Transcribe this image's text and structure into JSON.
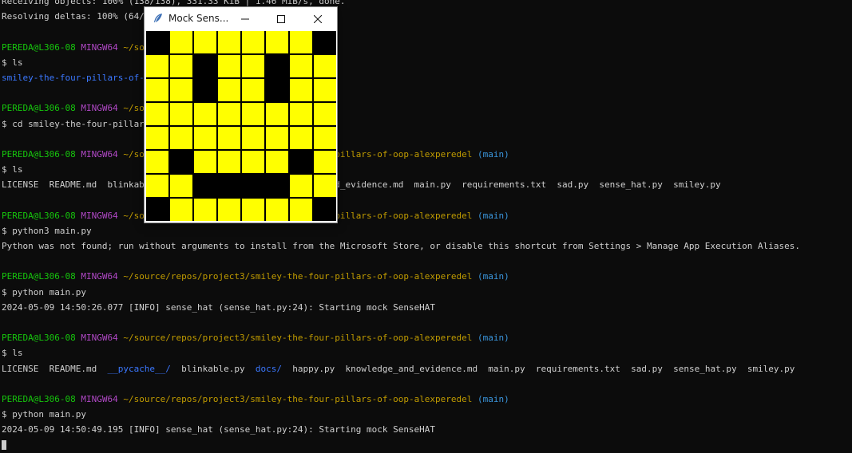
{
  "terminal": {
    "lines": [
      [
        {
          "t": "Receiving objects: 100% (138/138), 331.33 KiB | 1.46 MiB/s, done.",
          "c": "text"
        }
      ],
      [
        {
          "t": "Resolving deltas: 100% (64/64), done.",
          "c": "text"
        }
      ],
      [],
      [
        {
          "t": "PEREDA@L306-08",
          "c": "green"
        },
        {
          "t": " ",
          "c": "text"
        },
        {
          "t": "MINGW64",
          "c": "magenta"
        },
        {
          "t": " ~/source/repos/project3",
          "c": "yellow"
        }
      ],
      [
        {
          "t": "$ ls",
          "c": "text"
        }
      ],
      [
        {
          "t": "smiley-the-four-pillars-of-oop-alexperedel/",
          "c": "blue"
        }
      ],
      [],
      [
        {
          "t": "PEREDA@L306-08",
          "c": "green"
        },
        {
          "t": " ",
          "c": "text"
        },
        {
          "t": "MINGW64",
          "c": "magenta"
        },
        {
          "t": " ~/source/repos/project3",
          "c": "yellow"
        }
      ],
      [
        {
          "t": "$ cd smiley-the-four-pillars-of-oop-alexperedel/",
          "c": "text"
        }
      ],
      [],
      [
        {
          "t": "PEREDA@L306-08",
          "c": "green"
        },
        {
          "t": " ",
          "c": "text"
        },
        {
          "t": "MINGW64",
          "c": "magenta"
        },
        {
          "t": " ~/source/repos/project3/smiley-the-four-pillars-of-oop-alexperedel",
          "c": "yellow"
        },
        {
          "t": " (main)",
          "c": "cyan"
        }
      ],
      [
        {
          "t": "$ ls",
          "c": "text"
        }
      ],
      [
        {
          "t": "LICENSE  README.md  blinkable.py  docs/  happy.py  knowledge_and_evidence.md  main.py  requirements.txt  sad.py  sense_hat.py  smiley.py",
          "c": "text"
        }
      ],
      [],
      [
        {
          "t": "PEREDA@L306-08",
          "c": "green"
        },
        {
          "t": " ",
          "c": "text"
        },
        {
          "t": "MINGW64",
          "c": "magenta"
        },
        {
          "t": " ~/source/repos/project3/smiley-the-four-pillars-of-oop-alexperedel",
          "c": "yellow"
        },
        {
          "t": " (main)",
          "c": "cyan"
        }
      ],
      [
        {
          "t": "$ python3 main.py",
          "c": "text"
        }
      ],
      [
        {
          "t": "Python was not found; run without arguments to install from the Microsoft Store, or disable this shortcut from Settings > Manage App Execution Aliases.",
          "c": "text"
        }
      ],
      [],
      [
        {
          "t": "PEREDA@L306-08",
          "c": "green"
        },
        {
          "t": " ",
          "c": "text"
        },
        {
          "t": "MINGW64",
          "c": "magenta"
        },
        {
          "t": " ~/source/repos/project3/smiley-the-four-pillars-of-oop-alexperedel",
          "c": "yellow"
        },
        {
          "t": " (main)",
          "c": "cyan"
        }
      ],
      [
        {
          "t": "$ python main.py",
          "c": "text"
        }
      ],
      [
        {
          "t": "2024-05-09 14:50:26.077 [INFO] sense_hat (sense_hat.py:24): Starting mock SenseHAT",
          "c": "text"
        }
      ],
      [],
      [
        {
          "t": "PEREDA@L306-08",
          "c": "green"
        },
        {
          "t": " ",
          "c": "text"
        },
        {
          "t": "MINGW64",
          "c": "magenta"
        },
        {
          "t": " ~/source/repos/project3/smiley-the-four-pillars-of-oop-alexperedel",
          "c": "yellow"
        },
        {
          "t": " (main)",
          "c": "cyan"
        }
      ],
      [
        {
          "t": "$ ls",
          "c": "text"
        }
      ],
      [
        {
          "t": "LICENSE  README.md  ",
          "c": "text"
        },
        {
          "t": "__pycache__/",
          "c": "blue"
        },
        {
          "t": "  blinkable.py  ",
          "c": "text"
        },
        {
          "t": "docs/",
          "c": "blue"
        },
        {
          "t": "  happy.py  knowledge_and_evidence.md  main.py  requirements.txt  sad.py  sense_hat.py  smiley.py",
          "c": "text"
        }
      ],
      [],
      [
        {
          "t": "PEREDA@L306-08",
          "c": "green"
        },
        {
          "t": " ",
          "c": "text"
        },
        {
          "t": "MINGW64",
          "c": "magenta"
        },
        {
          "t": " ~/source/repos/project3/smiley-the-four-pillars-of-oop-alexperedel",
          "c": "yellow"
        },
        {
          "t": " (main)",
          "c": "cyan"
        }
      ],
      [
        {
          "t": "$ python main.py",
          "c": "text"
        }
      ],
      [
        {
          "t": "2024-05-09 14:50:49.195 [INFO] sense_hat (sense_hat.py:24): Starting mock SenseHAT",
          "c": "text"
        }
      ]
    ]
  },
  "mock_window": {
    "title": "Mock Sens...",
    "app_icon": "feather-icon",
    "buttons": {
      "minimize": "minimize-icon",
      "maximize": "maximize-icon",
      "close": "close-icon"
    }
  },
  "led_matrix": {
    "on_color": "#ffff00",
    "off_color": "#000000",
    "rows": [
      [
        0,
        1,
        1,
        1,
        1,
        1,
        1,
        0
      ],
      [
        1,
        1,
        0,
        1,
        1,
        0,
        1,
        1
      ],
      [
        1,
        1,
        0,
        1,
        1,
        0,
        1,
        1
      ],
      [
        1,
        1,
        1,
        1,
        1,
        1,
        1,
        1
      ],
      [
        1,
        1,
        1,
        1,
        1,
        1,
        1,
        1
      ],
      [
        1,
        0,
        1,
        1,
        1,
        1,
        0,
        1
      ],
      [
        1,
        1,
        0,
        0,
        0,
        0,
        1,
        1
      ],
      [
        0,
        1,
        1,
        1,
        1,
        1,
        1,
        0
      ]
    ]
  }
}
